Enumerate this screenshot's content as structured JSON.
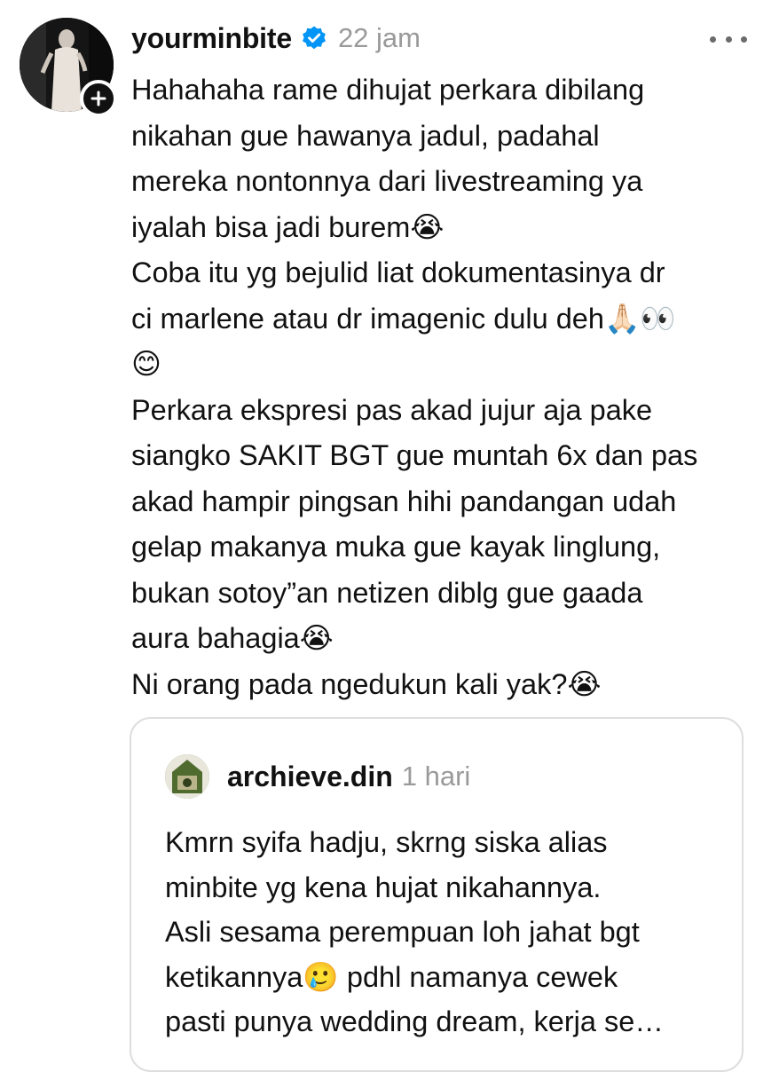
{
  "post": {
    "username": "yourminbite",
    "verified_icon": "verified-badge-icon",
    "timestamp": "22 jam",
    "more_icon": "more-options-icon",
    "follow_icon": "plus-icon",
    "lines": [
      "Hahahaha rame dihujat perkara dibilang",
      "nikahan gue hawanya jadul, padahal",
      "mereka nontonnya dari livestreaming ya",
      "iyalah bisa jadi burem😭",
      "Coba itu yg bejulid liat dokumentasinya dr",
      "ci marlene atau dr imagenic dulu deh🙏🏻👀",
      "😊",
      "Perkara ekspresi pas akad jujur aja pake",
      "siangko SAKIT BGT gue muntah 6x dan pas",
      "akad hampir pingsan hihi pandangan udah",
      "gelap makanya muka gue kayak linglung,",
      "bukan sotoy”an netizen diblg gue gaada",
      "aura bahagia😭",
      "Ni orang pada ngedukun kali yak?😭"
    ]
  },
  "quoted": {
    "username": "archieve.din",
    "timestamp": "1 hari",
    "lines": [
      "Kmrn syifa hadju, skrng siska alias",
      "minbite yg kena hujat nikahannya.",
      "Asli sesama perempuan loh jahat bgt",
      "ketikannya🥲 pdhl namanya cewek",
      "pasti punya wedding dream, kerja se…"
    ]
  },
  "colors": {
    "text": "#111111",
    "muted": "#9a9a9a",
    "verified": "#0095f6",
    "border": "#dedede"
  }
}
